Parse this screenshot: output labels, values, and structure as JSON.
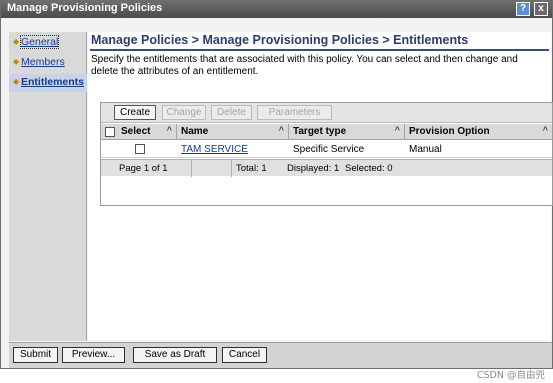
{
  "window": {
    "title": "Manage Provisioning Policies",
    "help_label": "?",
    "close_label": "x"
  },
  "sidebar": {
    "items": [
      {
        "label": "General"
      },
      {
        "label": "Members"
      },
      {
        "label": "Entitlements",
        "active": true
      }
    ]
  },
  "main": {
    "breadcrumb": "Manage Policies > Manage Provisioning Policies > Entitlements",
    "description": "Specify the entitlements that are associated with this policy. You can select and then change and delete the attributes of an entitlement.",
    "toolbar": {
      "create": "Create",
      "change": "Change",
      "delete": "Delete",
      "parameters": "Parameters"
    },
    "table": {
      "columns": [
        "Select",
        "Name",
        "Target type",
        "Provision Option"
      ],
      "rows": [
        {
          "name": "TAM SERVICE",
          "target_type": "Specific Service",
          "provision_option": "Manual"
        }
      ],
      "footer": {
        "page": "Page 1 of 1",
        "total": "Total: 1",
        "displayed": "Displayed: 1",
        "selected": "Selected: 0"
      }
    }
  },
  "actions": {
    "submit": "Submit",
    "preview": "Preview...",
    "save_draft": "Save as Draft",
    "cancel": "Cancel"
  },
  "watermark": "CSDN @自由兜"
}
